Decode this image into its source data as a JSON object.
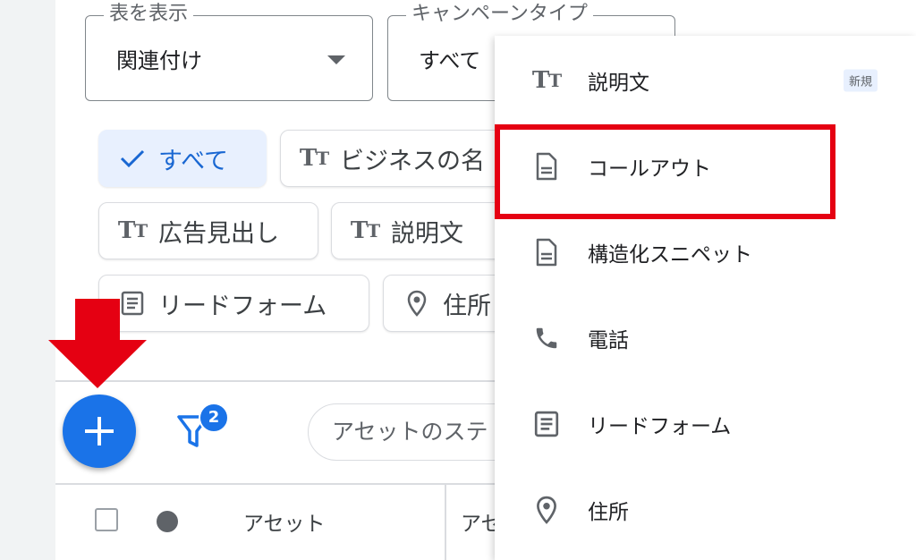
{
  "filters": {
    "table_view": {
      "label": "表を表示",
      "value": "関連付け"
    },
    "campaign_type": {
      "label": "キャンペーンタイプ",
      "value": "すべて"
    }
  },
  "chips": [
    {
      "label": "すべて"
    },
    {
      "label": "ビジネスの名"
    },
    {
      "label": "広告見出し"
    },
    {
      "label": "説明文"
    },
    {
      "label": "リードフォーム"
    },
    {
      "label": "住所"
    }
  ],
  "toolbar": {
    "filter_count": "2",
    "search_placeholder": "アセットのステ"
  },
  "table": {
    "columns": [
      "アセット",
      "アセ"
    ]
  },
  "menu": {
    "items": [
      {
        "label": "説明文",
        "icon": "text-fields-icon",
        "badge": "新規"
      },
      {
        "label": "コールアウト",
        "icon": "document-icon"
      },
      {
        "label": "構造化スニペット",
        "icon": "document-icon"
      },
      {
        "label": "電話",
        "icon": "phone-icon"
      },
      {
        "label": "リードフォーム",
        "icon": "list-form-icon"
      },
      {
        "label": "住所",
        "icon": "location-pin-icon"
      }
    ]
  },
  "colors": {
    "accent": "#1a73e8",
    "highlight": "#e50012",
    "arrow": "#e50012",
    "chip_active_bg": "#e8f0fe"
  }
}
